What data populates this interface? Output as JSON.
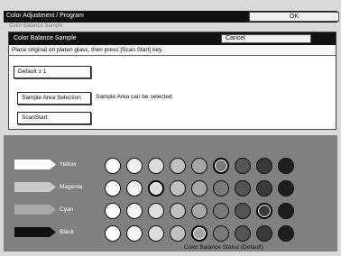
{
  "window": {
    "title": "Color Adjustment / Program",
    "ok_label": "OK"
  },
  "ghost_text": "Color Balance Sample",
  "dialog": {
    "title": "Color Balance Sample",
    "cancel_label": "Cancel",
    "instruction": "Place original on platen glass, then press [Scan Start] key.",
    "default_button": "Default ± 1",
    "sample_button": "Sample Area Selection",
    "sample_note": "Sample Area can be selected.",
    "scan_button": "ScanStart"
  },
  "balance": {
    "status_label": "Color Balance Status (Default)",
    "circle_shades": [
      "#ffffff",
      "#f3f3f3",
      "#dcdcdc",
      "#c0c0c0",
      "#a6a6a6",
      "#7a7a7a",
      "#555555",
      "#3a3a3a",
      "#1e1e1e"
    ],
    "rows": [
      {
        "name": "Yellow",
        "swatch": "#ffffff",
        "selected_index": 5
      },
      {
        "name": "Magenta",
        "swatch": "#c8c8c8",
        "selected_index": 2
      },
      {
        "name": "Cyan",
        "swatch": "#a8a8a8",
        "selected_index": 7
      },
      {
        "name": "Black",
        "swatch": "#111111",
        "selected_index": 4
      }
    ]
  }
}
